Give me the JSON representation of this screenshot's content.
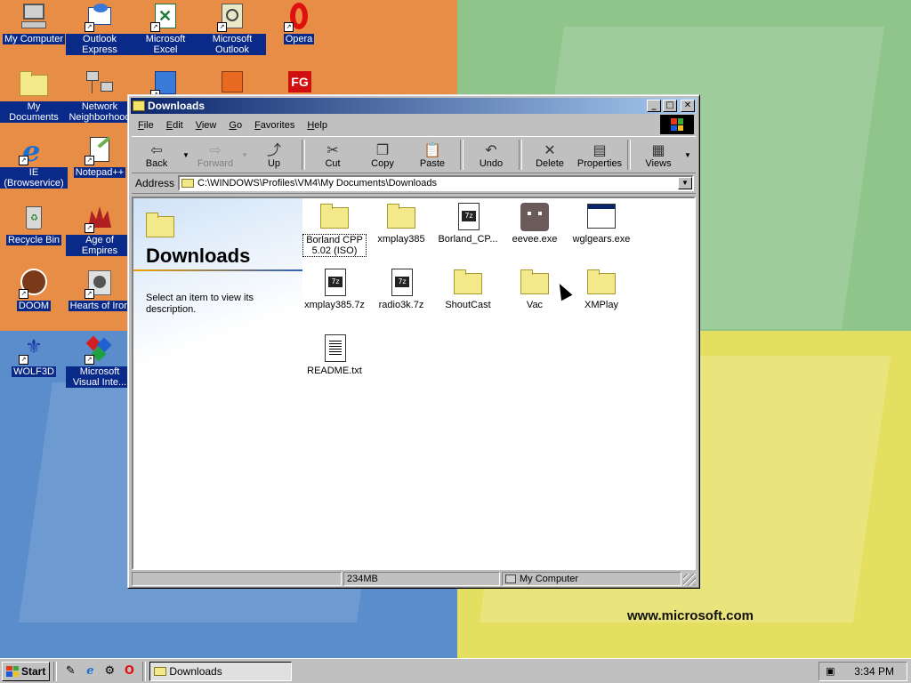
{
  "desktop": {
    "icons": [
      {
        "label": "My Computer"
      },
      {
        "label": "Outlook Express"
      },
      {
        "label": "Microsoft Excel"
      },
      {
        "label": "Microsoft Outlook"
      },
      {
        "label": "Opera"
      },
      {
        "label": "My Documents"
      },
      {
        "label": "Network Neighborhood"
      },
      {
        "label": "IE (Browservice)"
      },
      {
        "label": "Notepad++"
      },
      {
        "label": "Recycle Bin"
      },
      {
        "label": "Age of Empires"
      },
      {
        "label": "DOOM"
      },
      {
        "label": "Hearts of Iron"
      },
      {
        "label": "WOLF3D"
      },
      {
        "label": "Microsoft Visual Inte..."
      }
    ],
    "partial_icon_glyphs": {
      "fg": "FG"
    },
    "wallpaper_text": "www.microsoft.com"
  },
  "window": {
    "title": "Downloads",
    "controls": {
      "minimize": "_",
      "maximize": "□",
      "close": "✕"
    },
    "menu": [
      {
        "key": "F",
        "rest": "ile"
      },
      {
        "key": "E",
        "rest": "dit"
      },
      {
        "key": "V",
        "rest": "iew"
      },
      {
        "key": "G",
        "rest": "o"
      },
      {
        "key": "F",
        "rest": "avorites"
      },
      {
        "key": "H",
        "rest": "elp"
      }
    ],
    "toolbar": {
      "back": "Back",
      "forward": "Forward",
      "up": "Up",
      "cut": "Cut",
      "copy": "Copy",
      "paste": "Paste",
      "undo": "Undo",
      "delete": "Delete",
      "properties": "Properties",
      "views": "Views"
    },
    "address": {
      "label": "Address",
      "value": "C:\\WINDOWS\\Profiles\\VM4\\My Documents\\Downloads"
    },
    "left_pane": {
      "title": "Downloads",
      "description": "Select an item to view its description."
    },
    "files": [
      {
        "name": "Borland CPP 5.02 (ISO)",
        "type": "folder"
      },
      {
        "name": "xmplay385",
        "type": "folder"
      },
      {
        "name": "Borland_CP...",
        "type": "7z"
      },
      {
        "name": "eevee.exe",
        "type": "exe-pet"
      },
      {
        "name": "wglgears.exe",
        "type": "exe"
      },
      {
        "name": "xmplay385.7z",
        "type": "7z"
      },
      {
        "name": "radio3k.7z",
        "type": "7z"
      },
      {
        "name": "ShoutCast",
        "type": "folder"
      },
      {
        "name": "Vac",
        "type": "folder"
      },
      {
        "name": "XMPlay",
        "type": "folder"
      },
      {
        "name": "README.txt",
        "type": "txt"
      }
    ],
    "icon_glyph_7z": "7z",
    "status": {
      "size": "234MB",
      "zone": "My Computer"
    }
  },
  "taskbar": {
    "start": "Start",
    "task": "Downloads",
    "clock": "3:34 PM"
  }
}
